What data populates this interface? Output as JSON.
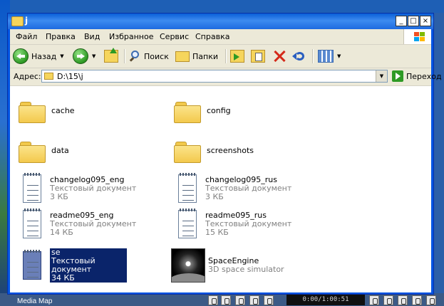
{
  "desktop": {
    "caption": "Media Map",
    "clock": "0:00/1:00:51"
  },
  "window": {
    "title": "j",
    "buttons": {
      "minimize": "_",
      "maximize": "□",
      "close": "×"
    }
  },
  "menu": [
    "Файл",
    "Правка",
    "Вид",
    "Избранное",
    "Сервис",
    "Справка"
  ],
  "toolbar": {
    "back_label": "Назад",
    "search_label": "Поиск",
    "folders_label": "Папки"
  },
  "address": {
    "label": "Адрес:",
    "value": "D:\\15\\j",
    "go_label": "Переход"
  },
  "files": [
    {
      "name": "cache"
    },
    {
      "name": "config"
    },
    {
      "name": "data"
    },
    {
      "name": "screenshots"
    },
    {
      "name": "changelog095_eng",
      "type": "Текстовый документ",
      "size": "3 КБ"
    },
    {
      "name": "changelog095_rus",
      "type": "Текстовый документ",
      "size": "3 КБ"
    },
    {
      "name": "readme095_eng",
      "type": "Текстовый документ",
      "size": "14 КБ"
    },
    {
      "name": "readme095_rus",
      "type": "Текстовый документ",
      "size": "15 КБ"
    },
    {
      "name": "se",
      "type": "Текстовый документ",
      "size": "34 КБ"
    },
    {
      "name": "SpaceEngine",
      "type": "3D space simulator"
    }
  ]
}
